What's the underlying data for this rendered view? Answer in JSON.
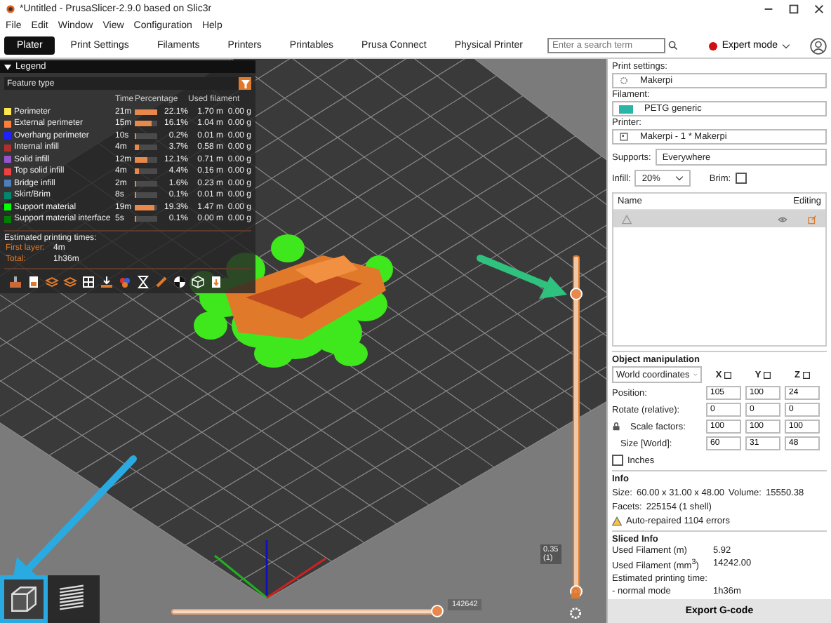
{
  "window": {
    "title": "*Untitled - PrusaSlicer-2.9.0 based on Slic3r"
  },
  "menu": [
    "File",
    "Edit",
    "Window",
    "View",
    "Configuration",
    "Help"
  ],
  "tabs": [
    {
      "label": "Plater",
      "selected": true
    },
    {
      "label": "Print Settings",
      "selected": false
    },
    {
      "label": "Filaments",
      "selected": false
    },
    {
      "label": "Printers",
      "selected": false
    },
    {
      "label": "Printables",
      "selected": false
    },
    {
      "label": "Prusa Connect",
      "selected": false
    },
    {
      "label": "Physical Printer",
      "selected": false
    }
  ],
  "search": {
    "placeholder": "Enter a search term"
  },
  "mode": {
    "label": "Expert mode"
  },
  "legend": {
    "title": "Legend",
    "view_type": "Feature type",
    "columns": [
      "Time",
      "Percentage",
      "Used filament"
    ],
    "rows": [
      {
        "name": "Perimeter",
        "color": "#ffe64d",
        "time": "21m",
        "level": 1.0,
        "percentage": "22.1%",
        "length": "1.70 m",
        "weight": "0.00 g"
      },
      {
        "name": "External perimeter",
        "color": "#ff7d38",
        "time": "15m",
        "level": 0.73,
        "percentage": "16.1%",
        "length": "1.04 m",
        "weight": "0.00 g"
      },
      {
        "name": "Overhang perimeter",
        "color": "#1f1fff",
        "time": "10s",
        "level": 0.02,
        "percentage": "0.2%",
        "length": "0.01 m",
        "weight": "0.00 g"
      },
      {
        "name": "Internal infill",
        "color": "#b03029",
        "time": "4m",
        "level": 0.17,
        "percentage": "3.7%",
        "length": "0.58 m",
        "weight": "0.00 g"
      },
      {
        "name": "Solid infill",
        "color": "#9654cc",
        "time": "12m",
        "level": 0.55,
        "percentage": "12.1%",
        "length": "0.71 m",
        "weight": "0.00 g"
      },
      {
        "name": "Top solid infill",
        "color": "#f04040",
        "time": "4m",
        "level": 0.2,
        "percentage": "4.4%",
        "length": "0.16 m",
        "weight": "0.00 g"
      },
      {
        "name": "Bridge infill",
        "color": "#4d80ba",
        "time": "2m",
        "level": 0.07,
        "percentage": "1.6%",
        "length": "0.23 m",
        "weight": "0.00 g"
      },
      {
        "name": "Skirt/Brim",
        "color": "#00876e",
        "time": "8s",
        "level": 0.02,
        "percentage": "0.1%",
        "length": "0.01 m",
        "weight": "0.00 g"
      },
      {
        "name": "Support material",
        "color": "#00ff00",
        "time": "19m",
        "level": 0.87,
        "percentage": "19.3%",
        "length": "1.47 m",
        "weight": "0.00 g"
      },
      {
        "name": "Support material interface",
        "color": "#008000",
        "time": "5s",
        "level": 0.02,
        "percentage": "0.1%",
        "length": "0.00 m",
        "weight": "0.00 g"
      }
    ],
    "times_heading": "Estimated printing times:",
    "times": [
      {
        "label": "First layer:",
        "value": "4m"
      },
      {
        "label": "Total:",
        "value": "1h36m"
      }
    ]
  },
  "view_buttons": [
    {
      "kind": "editor",
      "selected": true
    },
    {
      "kind": "preview",
      "selected": false
    }
  ],
  "vertical_slider": {
    "level": 0.89,
    "reading": "0.35",
    "layer": "(1)"
  },
  "horizontal_slider": {
    "level": 1.0,
    "reading": "142642"
  },
  "sidebar": {
    "print_settings": {
      "label": "Print settings:",
      "value": "Makerpi"
    },
    "filament": {
      "label": "Filament:",
      "value": "PETG generic"
    },
    "printer": {
      "label": "Printer:",
      "value": "Makerpi - 1 * Makerpi"
    },
    "supports": {
      "label": "Supports:",
      "value": "Everywhere"
    },
    "infill": {
      "label": "Infill:",
      "value": "20%"
    },
    "brim": {
      "label": "Brim:",
      "checked": false
    },
    "object_list": {
      "columns": [
        "Name",
        "Editing"
      ],
      "rows": [
        {
          "selected": true
        }
      ]
    },
    "object_manipulation": {
      "title": "Object manipulation",
      "coordinates": "World coordinates",
      "axes": [
        "X",
        "Y",
        "Z"
      ],
      "rows": [
        {
          "label": "Position:",
          "values": [
            "105",
            "100",
            "24"
          ]
        },
        {
          "label": "Rotate (relative):",
          "values": [
            "0",
            "0",
            "0"
          ]
        },
        {
          "label": "Scale factors:",
          "values": [
            "100",
            "100",
            "100"
          ]
        },
        {
          "label": "Size [World]:",
          "values": [
            "60",
            "31",
            "48"
          ]
        }
      ],
      "inches": {
        "label": "Inches",
        "checked": false
      }
    },
    "info": {
      "title": "Info",
      "size_label": "Size:",
      "size": "60.00 x 31.00 x 48.00",
      "volume_label": "Volume:",
      "volume": "15550.38",
      "facets_label": "Facets:",
      "facets": "225154 (1 shell)",
      "warning": "Auto-repaired 1104 errors"
    },
    "sliced_info": {
      "title": "Sliced Info",
      "rows": [
        {
          "label": "Used Filament (m)",
          "value": "5.92"
        },
        {
          "label": "Used Filament (mm$^{3}$)",
          "value": "14242.00"
        },
        {
          "label": "Estimated printing time:"
        },
        {
          "label": "- normal mode",
          "value": "1h36m"
        }
      ]
    },
    "export_button": "Export G-code"
  }
}
